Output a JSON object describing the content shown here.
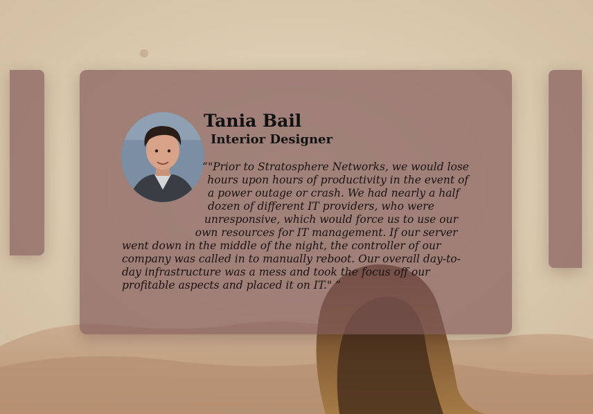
{
  "testimonial": {
    "name": "Tania Bail",
    "role": "Interior Designer",
    "quote": "“\"Prior to Stratosphere Networks, we would lose hours upon hours of productivity in the event of a power outage or crash. We had nearly a half dozen of different IT providers, who were unresponsive, which would force us to use our own resources for IT management. If our server went down in the middle of the night, the controller of our company was called in to manually reboot. Our overall day-to-day infrastructure was a mess and took the focus off our profitable aspects and placed it on IT.\" ”"
  },
  "colors": {
    "card": "#825a5a",
    "text": "#111111"
  },
  "icons": {
    "avatar": "person-photo"
  }
}
